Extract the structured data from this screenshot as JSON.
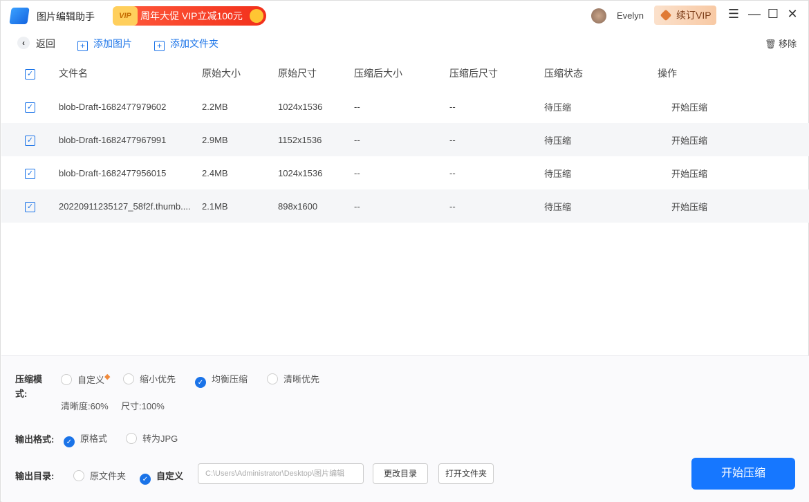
{
  "app": {
    "title": "图片编辑助手",
    "promo": "周年大促 VIP立减100元",
    "promo_badge": "VIP",
    "user": "Evelyn",
    "vip_button": "续订VIP"
  },
  "toolbar": {
    "back": "返回",
    "add_image": "添加图片",
    "add_folder": "添加文件夹",
    "remove": "移除"
  },
  "table": {
    "headers": [
      "文件名",
      "原始大小",
      "原始尺寸",
      "压缩后大小",
      "压缩后尺寸",
      "压缩状态",
      "操作"
    ],
    "rows": [
      {
        "name": "blob-Draft-1682477979602",
        "size": "2.2MB",
        "dim": "1024x1536",
        "csize": "--",
        "cdim": "--",
        "status": "待压缩",
        "action": "开始压缩"
      },
      {
        "name": "blob-Draft-1682477967991",
        "size": "2.9MB",
        "dim": "1152x1536",
        "csize": "--",
        "cdim": "--",
        "status": "待压缩",
        "action": "开始压缩"
      },
      {
        "name": "blob-Draft-1682477956015",
        "size": "2.4MB",
        "dim": "1024x1536",
        "csize": "--",
        "cdim": "--",
        "status": "待压缩",
        "action": "开始压缩"
      },
      {
        "name": "20220911235127_58f2f.thumb....",
        "size": "2.1MB",
        "dim": "898x1600",
        "csize": "--",
        "cdim": "--",
        "status": "待压缩",
        "action": "开始压缩"
      }
    ]
  },
  "settings": {
    "mode_label": "压缩模",
    "mode_label2": "式:",
    "modes": [
      "自定义",
      "缩小优先",
      "均衡压缩",
      "清晰优先"
    ],
    "clarity": "清晰度:60%",
    "size": "尺寸:100%",
    "format_label": "输出格式:",
    "formats": [
      "原格式",
      "转为JPG"
    ],
    "dir_label": "输出目录:",
    "dirs": [
      "原文件夹",
      "自定义"
    ],
    "path": "C:\\Users\\Administrator\\Desktop\\图片编辑",
    "change_dir": "更改目录",
    "open_folder": "打开文件夹",
    "start": "开始压缩"
  }
}
